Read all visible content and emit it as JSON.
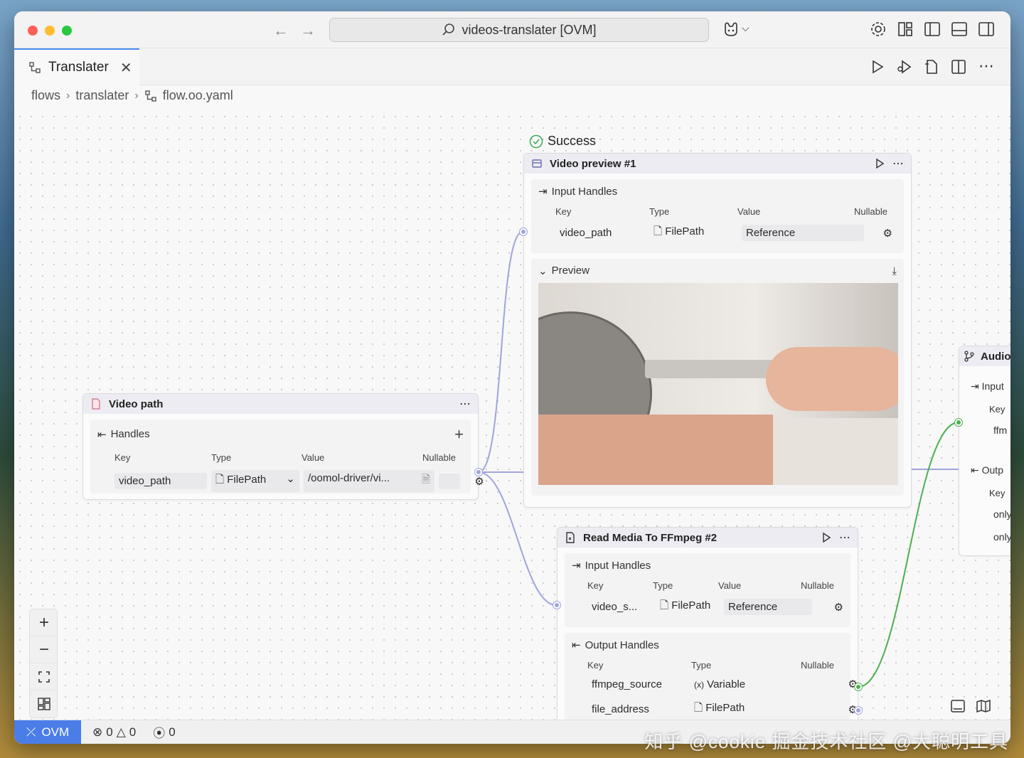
{
  "window": {
    "search_text": "videos-translater [OVM]"
  },
  "tab": {
    "label": "Translater"
  },
  "breadcrumbs": [
    "flows",
    "translater",
    "flow.oo.yaml"
  ],
  "status_label": "Success",
  "video_preview_node": {
    "title": "Video preview #1",
    "input_section": "Input Handles",
    "columns": [
      "Key",
      "Type",
      "Value",
      "Nullable"
    ],
    "row": {
      "key": "video_path",
      "type": "FilePath",
      "value": "Reference"
    },
    "preview_section": "Preview"
  },
  "video_path_node": {
    "title": "Video path",
    "section": "Handles",
    "columns": [
      "Key",
      "Type",
      "Value",
      "Nullable"
    ],
    "row": {
      "key": "video_path",
      "type": "FilePath",
      "value": "/oomol-driver/vi..."
    }
  },
  "read_media_node": {
    "title": "Read Media To FFmpeg #2",
    "input_section": "Input Handles",
    "input_columns": [
      "Key",
      "Type",
      "Value",
      "Nullable"
    ],
    "input_row": {
      "key": "video_s...",
      "type": "FilePath",
      "value": "Reference"
    },
    "output_section": "Output Handles",
    "output_columns": [
      "Key",
      "Type",
      "Nullable"
    ],
    "output_rows": [
      {
        "key": "ffmpeg_source",
        "type": "Variable"
      },
      {
        "key": "file_address",
        "type": "FilePath"
      }
    ]
  },
  "audio_node": {
    "title": "Audio",
    "input_section": "Input",
    "input_key_header": "Key",
    "input_key": "ffm",
    "output_section": "Outp",
    "output_key_header": "Key",
    "output_keys": [
      "only",
      "only"
    ]
  },
  "statusbar": {
    "ovm_label": "OVM",
    "errors": "0",
    "warnings": "0",
    "ports": "0"
  },
  "watermark": "知乎 @cookie 掘金技术社区 @大聪明工具",
  "colors": {
    "accent": "#4a7de8",
    "edge_purple": "#a0a4dd",
    "edge_green": "#4caf50",
    "success": "#3fae5a"
  }
}
